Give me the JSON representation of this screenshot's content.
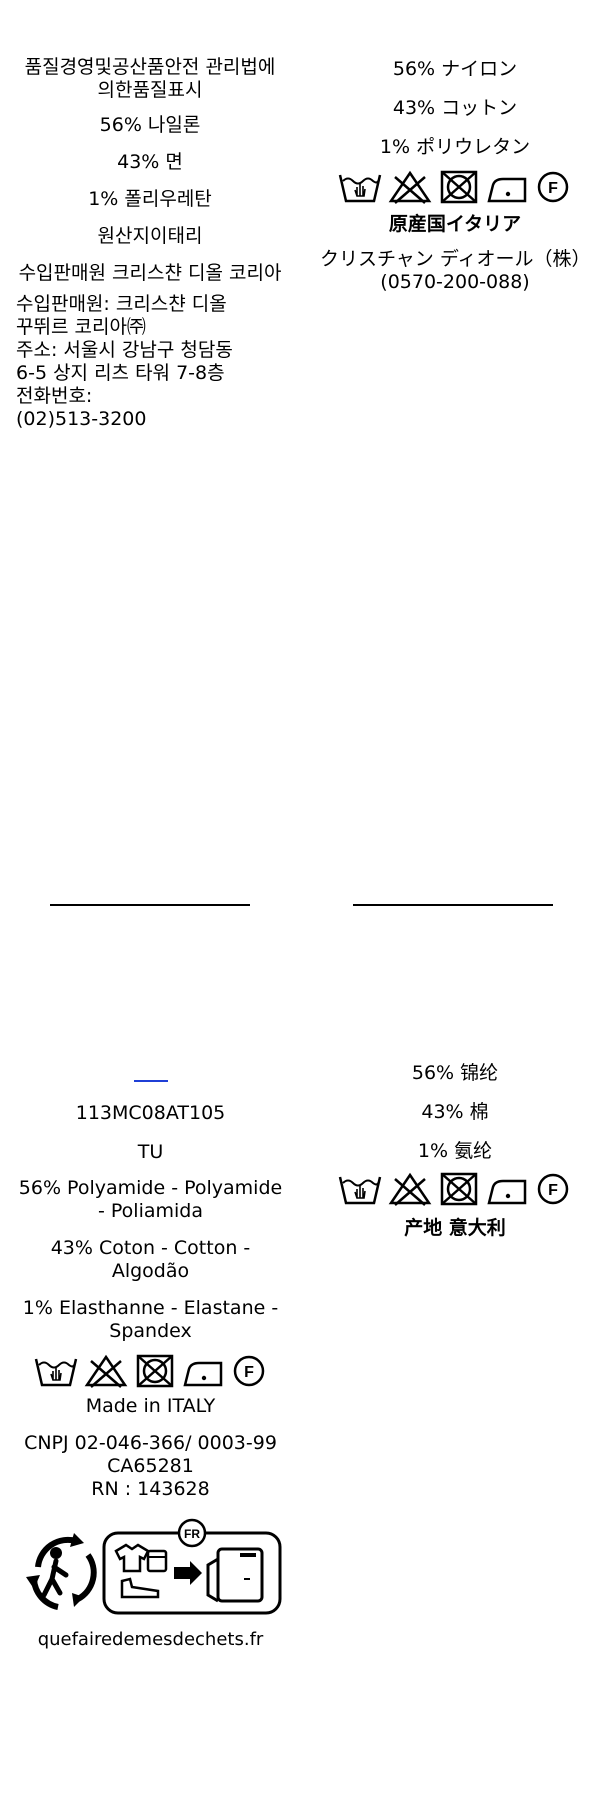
{
  "korean": {
    "lines": [
      "품질경영및공산품안전 관리법에의한품질표시",
      "56% 나일론",
      "43% 면",
      "1% 폴리우레탄",
      "원산지이태리",
      "수입판매원 크리스챤 디올 코리아"
    ],
    "address": [
      "수입판매원: 크리스챤 디올",
      "꾸뛰르 코리아㈜",
      "주소: 서울시 강남구 청담동",
      "6-5 상지 리츠 타워 7-8층",
      "전화번호:",
      "(02)513-3200"
    ]
  },
  "japanese": {
    "lines": [
      "56% ナイロン",
      "43% コットン",
      "1% ポリウレタン"
    ],
    "origin": "原産国イタリア",
    "company": "クリスチャン ディオール（株）",
    "phone": "(0570-200-088)"
  },
  "international": {
    "ref": "113MC08AT105",
    "size": "TU",
    "composition": [
      "56% Polyamide - Polyamide - Poliamida",
      "43% Coton - Cotton - Algodão",
      "1% Elasthanne - Elastane - Spandex"
    ],
    "made_in": "Made in ITALY",
    "codes": [
      "CNPJ 02-046-366/ 0003-99",
      "CA65281",
      "RN : 143628"
    ],
    "recycling_badge": "FR",
    "website": "quefairedemesdechets.fr"
  },
  "chinese": {
    "lines": [
      "56% 锦纶",
      "43% 棉",
      "1% 氨纶"
    ],
    "origin": "产地 意大利"
  },
  "care": {
    "icons": [
      "wash-30-icon",
      "no-bleach-icon",
      "no-tumble-dry-icon",
      "iron-low-icon",
      "dry-clean-f-icon"
    ],
    "dry_clean_letter": "F"
  }
}
